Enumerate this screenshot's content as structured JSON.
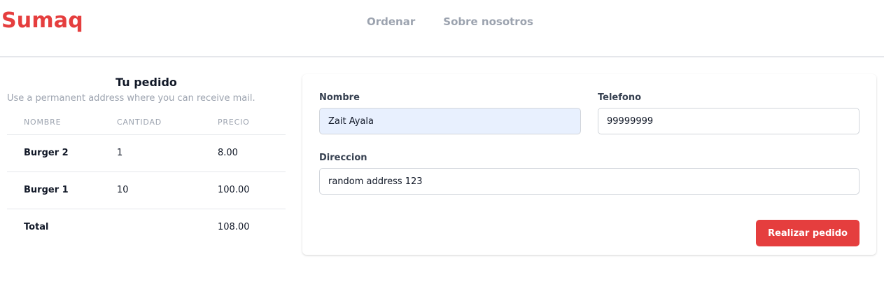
{
  "header": {
    "logo": "Sumaq",
    "nav": [
      {
        "label": "Ordenar"
      },
      {
        "label": "Sobre nosotros"
      }
    ]
  },
  "order": {
    "title": "Tu pedido",
    "subtitle": "Use a permanent address where you can receive mail.",
    "columns": [
      "NOMBRE",
      "CANTIDAD",
      "PRECIO"
    ],
    "rows": [
      {
        "name": "Burger 2",
        "quantity": "1",
        "price": "8.00"
      },
      {
        "name": "Burger 1",
        "quantity": "10",
        "price": "100.00"
      }
    ],
    "total": {
      "label": "Total",
      "quantity": "",
      "price": "108.00"
    }
  },
  "form": {
    "name": {
      "label": "Nombre",
      "value": "Zait Ayala"
    },
    "phone": {
      "label": "Telefono",
      "value": "99999999"
    },
    "address": {
      "label": "Direccion",
      "value": "random address 123"
    },
    "submit_label": "Realizar pedido"
  },
  "colors": {
    "brand": "#e53e3e",
    "nav_text": "#9ca3af",
    "autofill_bg": "#e8f0fe"
  }
}
